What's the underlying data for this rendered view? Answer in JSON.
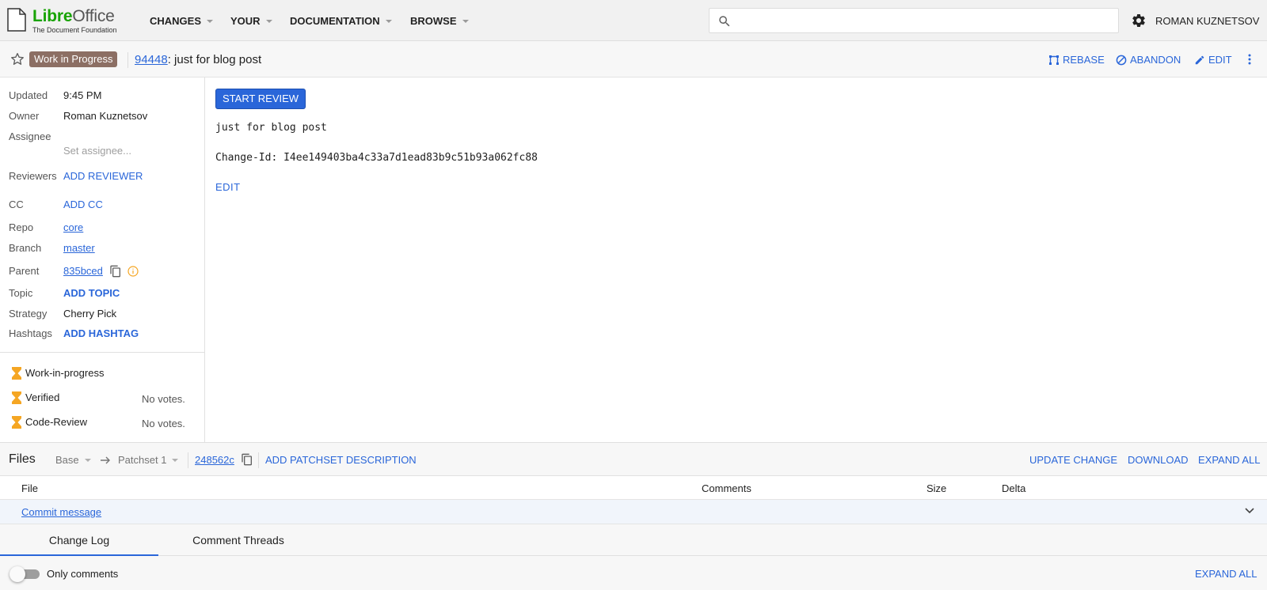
{
  "topbar": {
    "logo_part1": "Libre",
    "logo_part2": "Office",
    "logo_sub": "The Document Foundation",
    "menus": [
      "CHANGES",
      "YOUR",
      "DOCUMENTATION",
      "BROWSE"
    ],
    "search_value": "",
    "user": "ROMAN KUZNETSOV"
  },
  "header": {
    "status": "Work in Progress",
    "change_number": "94448",
    "change_subject": ": just for blog post",
    "actions": {
      "rebase": "REBASE",
      "abandon": "ABANDON",
      "edit": "EDIT"
    }
  },
  "meta": {
    "updated_label": "Updated",
    "updated_value": "9:45 PM",
    "owner_label": "Owner",
    "owner_value": "Roman Kuznetsov",
    "assignee_label": "Assignee",
    "assignee_placeholder": "Set assignee...",
    "reviewers_label": "Reviewers",
    "reviewers_action": "ADD REVIEWER",
    "cc_label": "CC",
    "cc_action": "ADD CC",
    "repo_label": "Repo",
    "repo_value": "core",
    "branch_label": "Branch",
    "branch_value": "master",
    "parent_label": "Parent",
    "parent_value": "835bced",
    "topic_label": "Topic",
    "topic_action": "ADD TOPIC",
    "strategy_label": "Strategy",
    "strategy_value": "Cherry Pick",
    "hashtags_label": "Hashtags",
    "hashtags_action": "ADD HASHTAG"
  },
  "labels": [
    {
      "name": "Work-in-progress",
      "votes": ""
    },
    {
      "name": "Verified",
      "votes": "No votes."
    },
    {
      "name": "Code-Review",
      "votes": "No votes."
    }
  ],
  "main": {
    "start_review": "START REVIEW",
    "commit_subject": "just for blog post",
    "change_id": "Change-Id: I4ee149403ba4c33a7d1ead83b9c51b93a062fc88",
    "edit": "EDIT"
  },
  "files": {
    "title": "Files",
    "base": "Base",
    "patchset": "Patchset 1",
    "commit": "248562c",
    "add_description": "ADD PATCHSET DESCRIPTION",
    "update_change": "UPDATE CHANGE",
    "download": "DOWNLOAD",
    "expand_all": "EXPAND ALL",
    "columns": {
      "file": "File",
      "comments": "Comments",
      "size": "Size",
      "delta": "Delta"
    },
    "rows": [
      {
        "name": "Commit message"
      }
    ]
  },
  "tabs": [
    "Change Log",
    "Comment Threads"
  ],
  "footer": {
    "only_comments": "Only comments",
    "expand_all": "EXPAND ALL"
  },
  "colors": {
    "accent": "#2a66d9",
    "wip_badge": "#8c6f64",
    "logo_green": "#18a303",
    "hourglass": "#f5a623"
  }
}
